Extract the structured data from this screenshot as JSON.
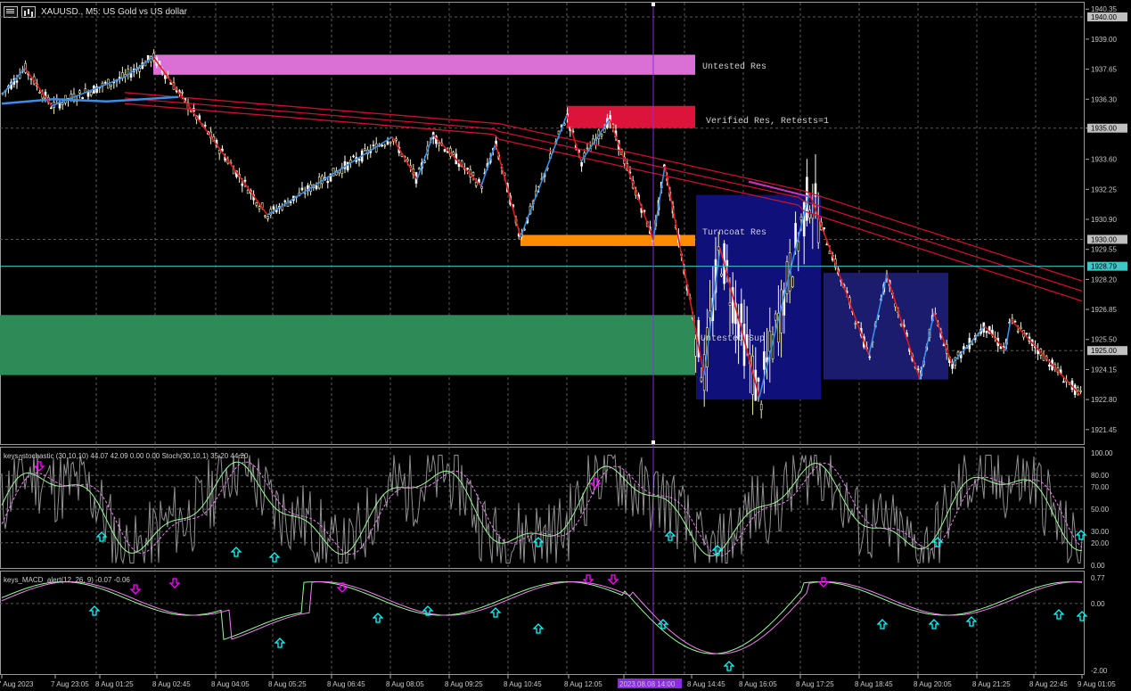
{
  "header": {
    "symbol_text": "XAUUSD., M5:  US Gold vs US dollar",
    "icon_menu": "chart-menu-icon",
    "icon_bars": "chart-type-icon"
  },
  "colors": {
    "background": "#000000",
    "grid": "#5a5a5a",
    "bull_candle": "#f5f0b4",
    "bear_candle": "#ffffff",
    "zigzag_up": "#3a8ee6",
    "zigzag_down": "#e01a1a",
    "ma_red": "#c8102e",
    "zone_untested_res": "#da70d6",
    "zone_verified_res": "#dc143c",
    "zone_turncoat_res": "#ff8c00",
    "zone_untested_sup": "#2e8b57",
    "box_dark_blue": "#10107a",
    "box_navy": "#1c1c6e",
    "price_line": "#3cc8c8",
    "crosshair": "#8a2be2",
    "stoch_main": "#98fb98",
    "stoch_signal": "#ee82ee",
    "macd_main": "#98fb98",
    "macd_signal": "#ee82ee",
    "arrow_up": "#00ffff",
    "arrow_down": "#ff00ff"
  },
  "zones": [
    {
      "name": "untested-res",
      "label": "Untested Res"
    },
    {
      "name": "verified-res",
      "label": "Verified Res, Retests=1"
    },
    {
      "name": "turncoat-res",
      "label": "Turncoat Res"
    },
    {
      "name": "untested-sup",
      "label": "Untested Sup"
    }
  ],
  "price_axis": {
    "ticks": [
      "1940.35",
      "1939.00",
      "1937.65",
      "1936.30",
      "1935.00",
      "1933.60",
      "1932.25",
      "1930.90",
      "1929.55",
      "1928.20",
      "1926.85",
      "1925.50",
      "1924.15",
      "1922.80",
      "1921.45"
    ],
    "tags": [
      {
        "text": "1940.00",
        "value": 1940.0,
        "bg": "#c0c0c0",
        "fg": "#000000"
      },
      {
        "text": "1935.00",
        "value": 1935.0,
        "bg": "#c0c0c0",
        "fg": "#000000"
      },
      {
        "text": "1930.00",
        "value": 1930.0,
        "bg": "#c0c0c0",
        "fg": "#000000"
      },
      {
        "text": "1928.79",
        "value": 1928.79,
        "bg": "#3cc8c8",
        "fg": "#000000"
      },
      {
        "text": "1925.00",
        "value": 1925.0,
        "bg": "#c0c0c0",
        "fg": "#000000"
      }
    ]
  },
  "stoch_pane": {
    "label": "keys_stochastic (30,10,10) 44.07 42.09 0.00 0.00 Stoch(30,10,1) 35.20 44.20",
    "ticks": [
      "100.00",
      "80.00",
      "70.00",
      "50.00",
      "30.00",
      "20.00",
      "0.00"
    ]
  },
  "macd_pane": {
    "label": "keys_MACD_alert(12, 26, 9) -0.07 -0.06",
    "ticks": [
      "0.77",
      "0.00",
      "-2.00"
    ]
  },
  "time_axis": {
    "labels": [
      "7 Aug 2023",
      "7 Aug 23:05",
      "8 Aug 01:25",
      "8 Aug 02:45",
      "8 Aug 04:05",
      "8 Aug 05:25",
      "8 Aug 06:45",
      "8 Aug 08:05",
      "8 Aug 09:25",
      "8 Aug 10:45",
      "8 Aug 12:05",
      "2023.08.08 14:00",
      "8 Aug 14:45",
      "8 Aug 16:05",
      "8 Aug 17:25",
      "8 Aug 18:45",
      "8 Aug 20:05",
      "8 Aug 21:25",
      "8 Aug 22:45",
      "9 Aug 01:05"
    ],
    "highlight_label": "2023.08.08 14:00",
    "highlight_bg": "#8a2be2"
  },
  "chart_data": {
    "type": "candlestick",
    "symbol": "XAUUSD.",
    "timeframe": "M5",
    "ylim": [
      1920.8,
      1940.6
    ],
    "last_price": 1928.79,
    "zigzag_points": [
      {
        "x": "7 Aug 2023",
        "y": 1936.5
      },
      {
        "x": "7 Aug 23:05",
        "y": 1937.7
      },
      {
        "x": "7 Aug 23:05",
        "y": 1936.0
      },
      {
        "x": "8 Aug 01:25",
        "y": 1937.3
      },
      {
        "x": "8 Aug 01:25",
        "y": 1938.2
      },
      {
        "x": "8 Aug 04:05",
        "y": 1931.1
      },
      {
        "x": "8 Aug 06:45",
        "y": 1934.6
      },
      {
        "x": "8 Aug 08:05",
        "y": 1932.7
      },
      {
        "x": "8 Aug 08:05",
        "y": 1934.7
      },
      {
        "x": "8 Aug 09:25",
        "y": 1932.4
      },
      {
        "x": "8 Aug 09:25",
        "y": 1934.3
      },
      {
        "x": "8 Aug 10:45",
        "y": 1930.1
      },
      {
        "x": "8 Aug 10:45",
        "y": 1935.6
      },
      {
        "x": "8 Aug 12:05",
        "y": 1933.5
      },
      {
        "x": "8 Aug 12:05",
        "y": 1935.4
      },
      {
        "x": "2023.08.08 14:00",
        "y": 1930.0
      },
      {
        "x": "2023.08.08 14:00",
        "y": 1933.3
      },
      {
        "x": "8 Aug 14:45",
        "y": 1923.9
      },
      {
        "x": "8 Aug 14:45",
        "y": 1929.6
      },
      {
        "x": "8 Aug 16:05",
        "y": 1922.9
      },
      {
        "x": "8 Aug 17:25",
        "y": 1932.1
      },
      {
        "x": "8 Aug 18:45",
        "y": 1924.8
      },
      {
        "x": "8 Aug 18:45",
        "y": 1928.4
      },
      {
        "x": "8 Aug 20:05",
        "y": 1923.7
      },
      {
        "x": "8 Aug 20:05",
        "y": 1926.7
      },
      {
        "x": "8 Aug 21:25",
        "y": 1924.4
      },
      {
        "x": "8 Aug 21:25",
        "y": 1926.1
      },
      {
        "x": "8 Aug 22:45",
        "y": 1925.0
      },
      {
        "x": "8 Aug 22:45",
        "y": 1926.4
      },
      {
        "x": "9 Aug 01:05",
        "y": 1923.0
      }
    ]
  }
}
